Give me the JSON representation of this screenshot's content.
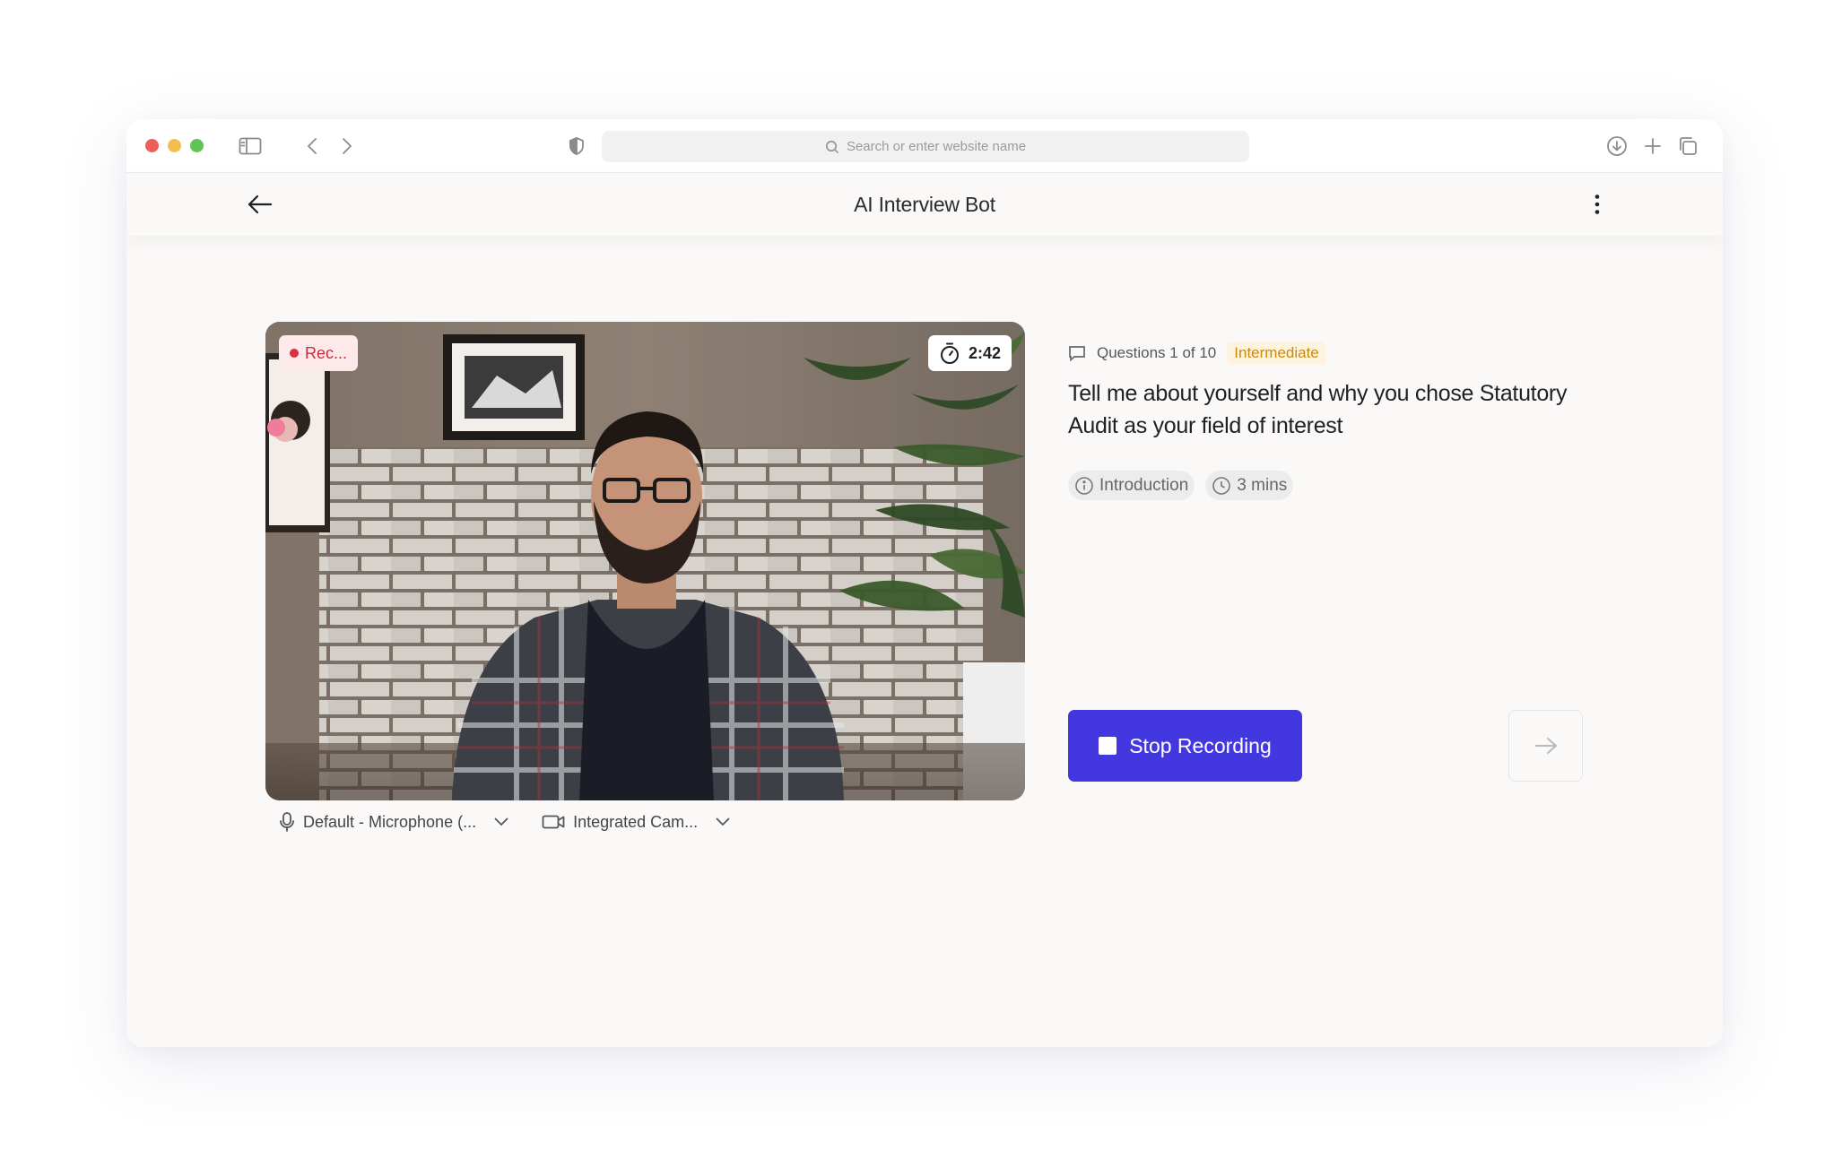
{
  "browser": {
    "address_placeholder": "Search or enter website name",
    "icons": [
      "sidebar-icon",
      "back-chevron-icon",
      "forward-chevron-icon",
      "shield-icon",
      "search-icon",
      "download-icon",
      "plus-icon",
      "tabs-icon"
    ]
  },
  "app": {
    "title": "AI Interview Bot"
  },
  "video": {
    "recording_label": "Rec...",
    "timer": "2:42"
  },
  "devices": {
    "microphone": "Default - Microphone (...",
    "camera": "Integrated Cam..."
  },
  "question": {
    "counter": "Questions 1 of 10",
    "level": "Intermediate",
    "text": "Tell me about yourself and why you chose Statutory Audit as your field of interest",
    "tags": {
      "category": "Introduction",
      "duration": "3 mins"
    }
  },
  "actions": {
    "stop_label": "Stop Recording"
  },
  "colors": {
    "primary": "#4338e0",
    "record_red": "#d4303f",
    "level_amber": "#c78a12"
  }
}
